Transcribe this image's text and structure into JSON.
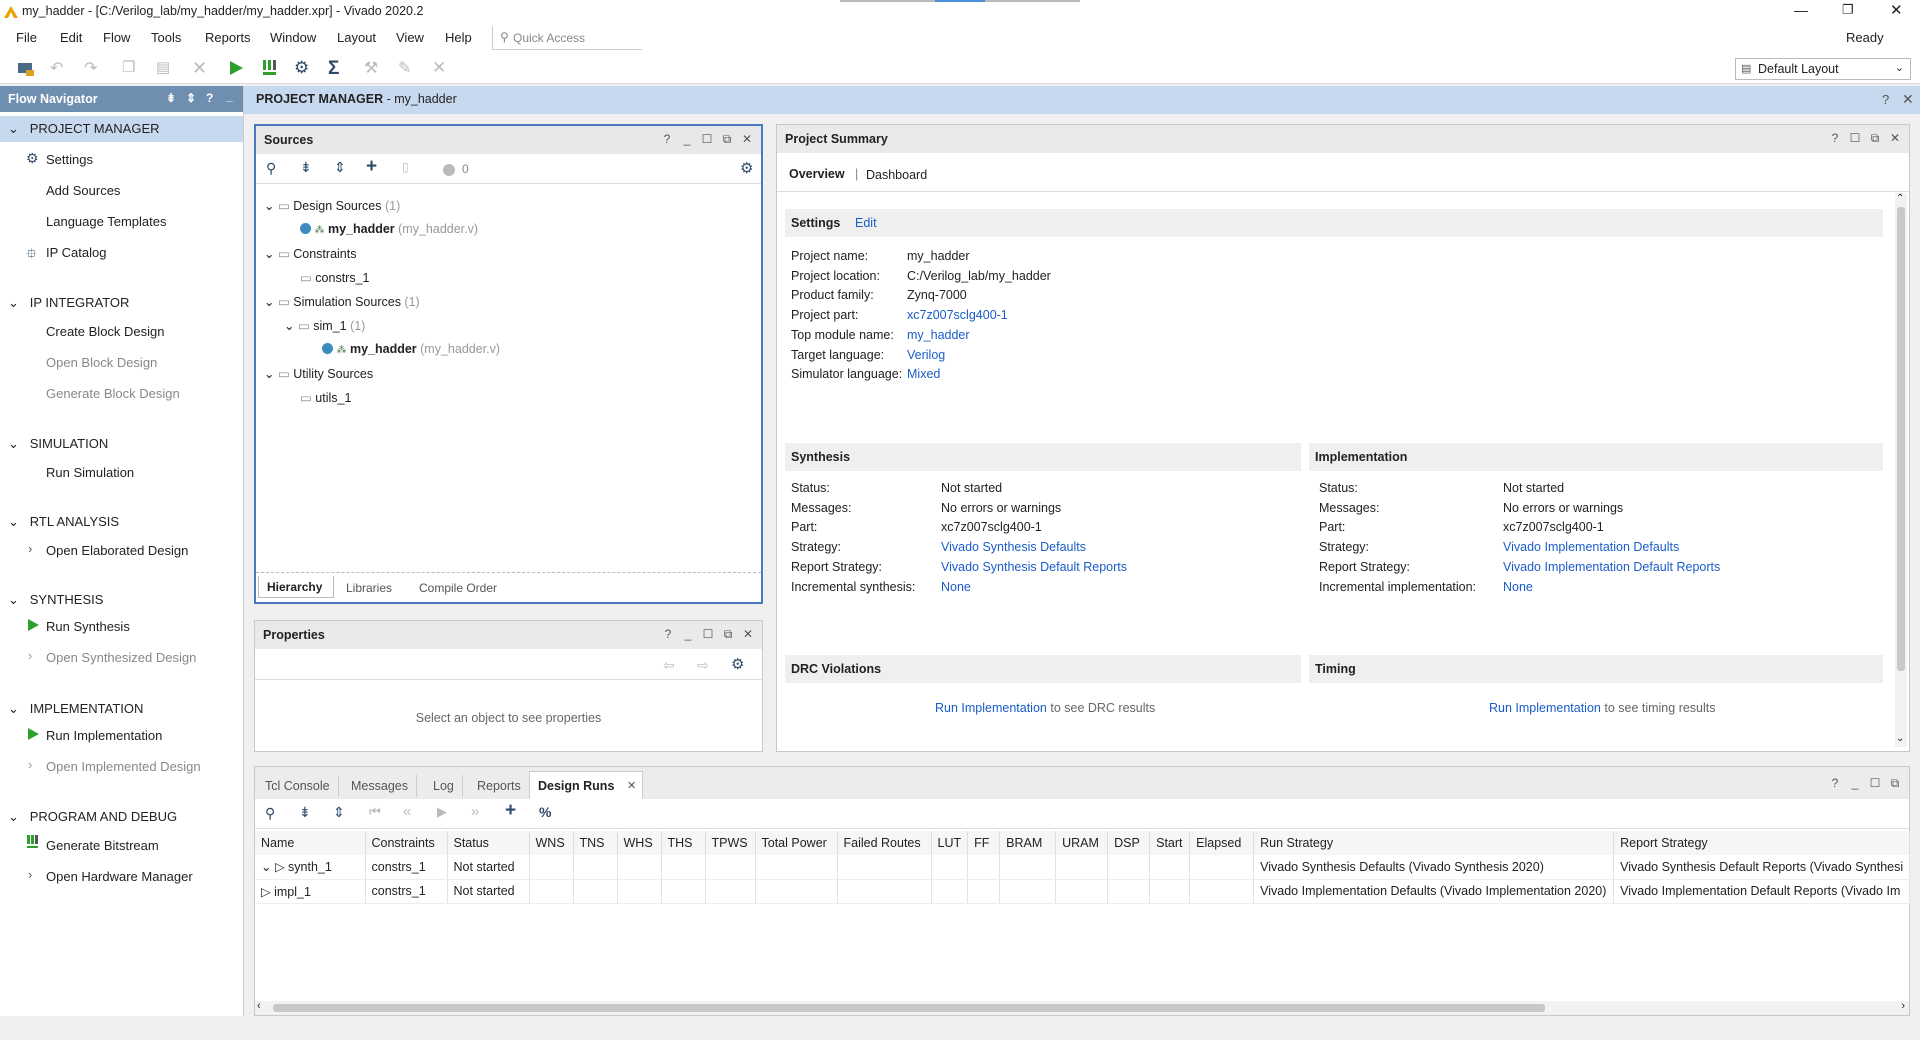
{
  "window": {
    "title": "my_hadder - [C:/Verilog_lab/my_hadder/my_hadder.xpr] - Vivado 2020.2",
    "status": "Ready"
  },
  "menu": [
    "File",
    "Edit",
    "Flow",
    "Tools",
    "Reports",
    "Window",
    "Layout",
    "View",
    "Help"
  ],
  "quick_access": {
    "placeholder": "Quick Access"
  },
  "layout_select": {
    "value": "Default Layout"
  },
  "flow_nav": {
    "title": "Flow Navigator",
    "sections": [
      {
        "label": "PROJECT MANAGER",
        "items": [
          "Settings",
          "Add Sources",
          "Language Templates",
          "IP Catalog"
        ]
      },
      {
        "label": "IP INTEGRATOR",
        "items": [
          "Create Block Design",
          "Open Block Design",
          "Generate Block Design"
        ]
      },
      {
        "label": "SIMULATION",
        "items": [
          "Run Simulation"
        ]
      },
      {
        "label": "RTL ANALYSIS",
        "items": [
          "Open Elaborated Design"
        ]
      },
      {
        "label": "SYNTHESIS",
        "items": [
          "Run Synthesis",
          "Open Synthesized Design"
        ]
      },
      {
        "label": "IMPLEMENTATION",
        "items": [
          "Run Implementation",
          "Open Implemented Design"
        ]
      },
      {
        "label": "PROGRAM AND DEBUG",
        "items": [
          "Generate Bitstream",
          "Open Hardware Manager"
        ]
      }
    ]
  },
  "pm_header": {
    "title": "PROJECT MANAGER",
    "project": " - my_hadder"
  },
  "sources": {
    "title": "Sources",
    "count": "0",
    "tree": {
      "design_sources": "Design Sources",
      "design_count": " (1)",
      "top": "my_hadder",
      "top_file": " (my_hadder.v)",
      "constraints": "Constraints",
      "constrs": "constrs_1",
      "sim_sources": "Simulation Sources",
      "sim_count": " (1)",
      "sim1": "sim_1",
      "sim1_count": " (1)",
      "sim_top": "my_hadder",
      "sim_top_file": " (my_hadder.v)",
      "utility": "Utility Sources",
      "utils": "utils_1"
    },
    "tabs": [
      "Hierarchy",
      "Libraries",
      "Compile Order"
    ]
  },
  "properties": {
    "title": "Properties",
    "empty": "Select an object to see properties"
  },
  "summary": {
    "title": "Project Summary",
    "tabs": [
      "Overview",
      "Dashboard"
    ],
    "settings": {
      "title": "Settings",
      "edit": "Edit",
      "rows": [
        {
          "k": "Project name:",
          "v": "my_hadder"
        },
        {
          "k": "Project location:",
          "v": "C:/Verilog_lab/my_hadder"
        },
        {
          "k": "Product family:",
          "v": "Zynq-7000"
        },
        {
          "k": "Project part:",
          "v": "xc7z007sclg400-1"
        },
        {
          "k": "Top module name:",
          "v": "my_hadder"
        },
        {
          "k": "Target language:",
          "v": "Verilog"
        },
        {
          "k": "Simulator language:",
          "v": "Mixed"
        }
      ]
    },
    "synthesis": {
      "title": "Synthesis",
      "rows": [
        {
          "k": "Status:",
          "v": "Not started"
        },
        {
          "k": "Messages:",
          "v": "No errors or warnings"
        },
        {
          "k": "Part:",
          "v": "xc7z007sclg400-1"
        },
        {
          "k": "Strategy:",
          "v": "Vivado Synthesis Defaults"
        },
        {
          "k": "Report Strategy:",
          "v": "Vivado Synthesis Default Reports"
        },
        {
          "k": "Incremental synthesis:",
          "v": "None"
        }
      ]
    },
    "implementation": {
      "title": "Implementation",
      "rows": [
        {
          "k": "Status:",
          "v": "Not started"
        },
        {
          "k": "Messages:",
          "v": "No errors or warnings"
        },
        {
          "k": "Part:",
          "v": "xc7z007sclg400-1"
        },
        {
          "k": "Strategy:",
          "v": "Vivado Implementation Defaults"
        },
        {
          "k": "Report Strategy:",
          "v": "Vivado Implementation Default Reports"
        },
        {
          "k": "Incremental implementation:",
          "v": "None"
        }
      ]
    },
    "drc": {
      "title": "DRC Violations",
      "link": "Run Implementation",
      "text": " to see DRC results"
    },
    "timing": {
      "title": "Timing",
      "link": "Run Implementation",
      "text": " to see timing results"
    }
  },
  "bottom": {
    "tabs": [
      "Tcl Console",
      "Messages",
      "Log",
      "Reports",
      "Design Runs"
    ],
    "columns": [
      "Name",
      "Constraints",
      "Status",
      "WNS",
      "TNS",
      "WHS",
      "THS",
      "TPWS",
      "Total Power",
      "Failed Routes",
      "LUT",
      "FF",
      "BRAM",
      "URAM",
      "DSP",
      "Start",
      "Elapsed",
      "Run Strategy",
      "Report Strategy"
    ],
    "rows": [
      {
        "name": "synth_1",
        "constraints": "constrs_1",
        "status": "Not started",
        "run": "Vivado Synthesis Defaults (Vivado Synthesis 2020)",
        "report": "Vivado Synthesis Default Reports (Vivado Synthesi"
      },
      {
        "name": "impl_1",
        "constraints": "constrs_1",
        "status": "Not started",
        "run": "Vivado Implementation Defaults (Vivado Implementation 2020)",
        "report": "Vivado Implementation Default Reports (Vivado Im"
      }
    ]
  }
}
